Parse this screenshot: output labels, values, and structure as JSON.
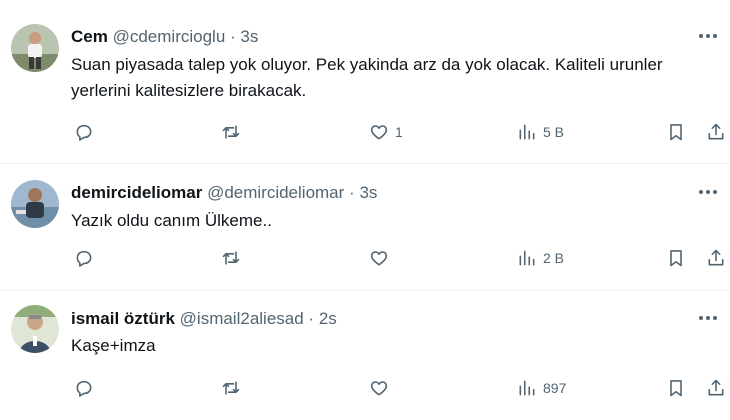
{
  "tweets": [
    {
      "name": "Cem",
      "handle": "@cdemircioglu",
      "separator": "·",
      "time": "3s",
      "text": "Suan piyasada talep yok oluyor. Pek yakinda arz da yok olacak. Kaliteli urunler yerlerini kalitesizlere birakacak.",
      "likes": "1",
      "views": "5 B"
    },
    {
      "name": "demircideliomar",
      "handle": "@demircideliomar",
      "separator": "·",
      "time": "3s",
      "text": "Yazık oldu canım Ülkeme..",
      "likes": "",
      "views": "2 B"
    },
    {
      "name": "ismail öztürk",
      "handle": "@ismail2aliesad",
      "separator": "·",
      "time": "2s",
      "text": "Kaşe+imza",
      "likes": "",
      "views": "897"
    }
  ],
  "icons": {
    "reply": "reply-icon",
    "retweet": "retweet-icon",
    "like": "like-icon",
    "views": "views-icon",
    "bookmark": "bookmark-icon",
    "share": "share-icon",
    "more": "more-icon"
  },
  "colors": {
    "text": "#0f1419",
    "muted": "#536471",
    "divider": "#eff3f4"
  }
}
